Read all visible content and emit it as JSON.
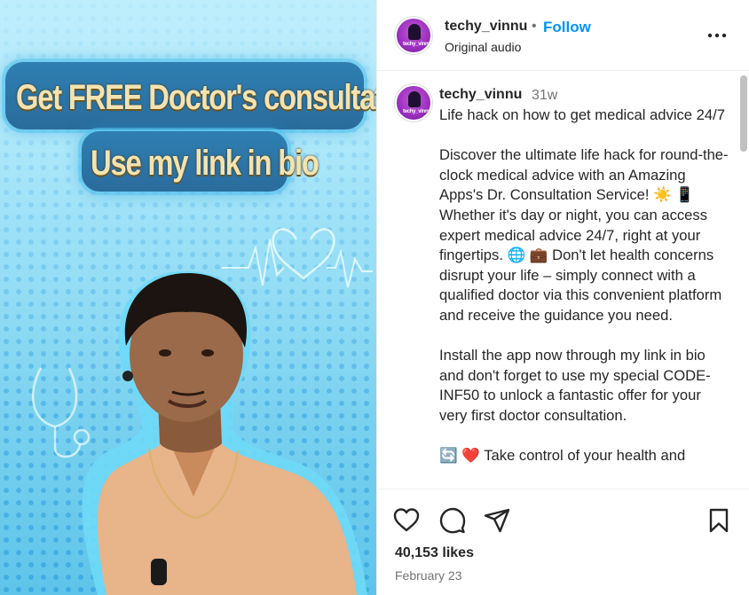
{
  "media": {
    "headline_line1": "Get FREE Doctor's consultation,",
    "headline_line2": "Use my link in bio"
  },
  "header": {
    "username": "techy_vinnu",
    "separator": "•",
    "follow_label": "Follow",
    "audio": "Original audio",
    "more_icon": "more-options-icon"
  },
  "avatar": {
    "label": "techy_vinnu"
  },
  "caption": {
    "username": "techy_vinnu",
    "time": "31w",
    "text": "Life hack on how to get medical advice 24/7\n\nDiscover the ultimate life hack for round-the-clock medical advice with an Amazing Apps's Dr. Consultation Service! ☀️ 📱 Whether it's day or night, you can access expert medical advice 24/7, right at your fingertips. 🌐 💼 Don't let health concerns disrupt your life – simply connect with a qualified doctor via this convenient platform and receive the guidance you need.\n\nInstall the app now through my link in bio and don't forget to use my special CODE-INF50 to unlock a fantastic offer for your very first doctor consultation.\n\n🔄 ❤️ Take control of your health and"
  },
  "actions": {
    "icons": [
      "heart-icon",
      "comment-icon",
      "share-icon",
      "bookmark-icon"
    ],
    "likes": "40,153 likes",
    "date": "February 23"
  },
  "colors": {
    "accent": "#0095f6",
    "text": "#262626",
    "muted": "#737373",
    "border": "#efefef",
    "media_bg": "#8fdcf4"
  }
}
